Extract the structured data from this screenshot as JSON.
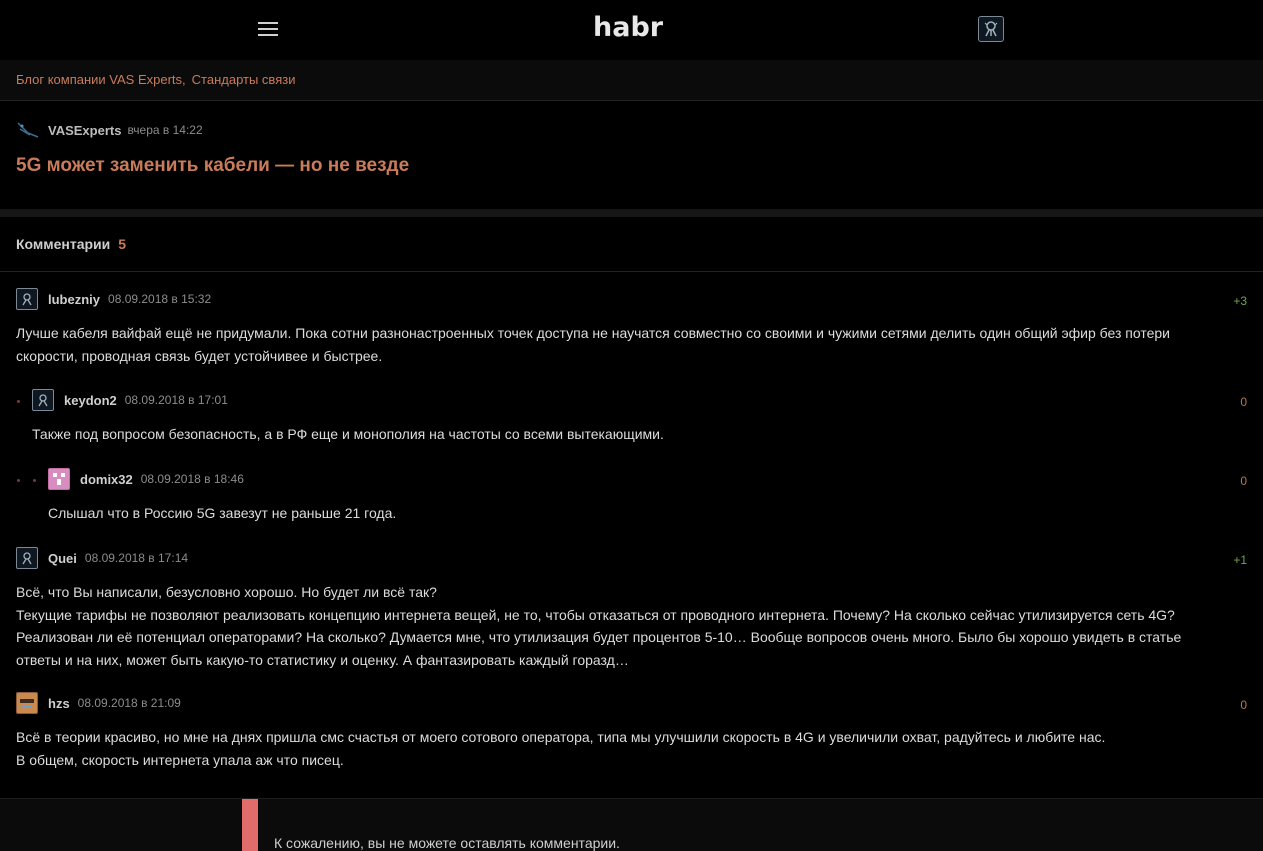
{
  "header": {
    "logo": "habr",
    "menu_icon": "hamburger-icon",
    "user_icon": "user-avatar-icon"
  },
  "hubs": [
    "Блог компании VAS Experts",
    "Стандарты связи"
  ],
  "post": {
    "author": "VASExperts",
    "time": "вчера в 14:22",
    "title": "5G может заменить кабели — но не везде"
  },
  "comments_header": {
    "label": "Комментарии",
    "count": "5"
  },
  "comments": [
    {
      "user": "lubezniy",
      "time": "08.09.2018 в 15:32",
      "score": "+3",
      "lines": [
        "Лучше кабеля вайфай ещё не придумали. Пока сотни разнонастроенных точек доступа не научатся совместно со своими и чужими сетями делить один общий эфир без потери",
        "скорости, проводная связь будет устойчивее и быстрее."
      ]
    },
    {
      "user": "keydon2",
      "time": "08.09.2018 в 17:01",
      "score": "0",
      "lines": [
        "Также под вопросом безопасность, а в РФ еще и монополия на частоты со всеми вытекающими."
      ]
    },
    {
      "user": "domix32",
      "time": "08.09.2018 в 18:46",
      "score": "0",
      "lines": [
        "Слышал что в Россию 5G завезут не раньше 21 года."
      ]
    },
    {
      "user": "Quei",
      "time": "08.09.2018 в 17:14",
      "score": "+1",
      "lines": [
        "Всё, что Вы написали, безусловно хорошо. Но будет ли всё так?",
        "Текущие тарифы не позволяют реализовать концепцию интернета вещей, не то, чтобы отказаться от проводного интернета. Почему? На сколько сейчас утилизируется сеть 4G?",
        "Реализован ли её потенциал операторами? На сколько? Думается мне, что утилизация будет процентов 5-10… Вообще вопросов очень много. Было бы хорошо увидеть в статье",
        "ответы и на них, может быть какую-то статистику и оценку. А фантазировать каждый горазд…"
      ]
    },
    {
      "user": "hzs",
      "time": "08.09.2018 в 21:09",
      "score": "0",
      "lines": [
        "Всё в теории красиво, но мне на днях пришла смс счастья от моего сотового оператора, типа мы улучшили скорость в 4G и увеличили охват, радуйтесь и любите нас.",
        "В общем, скорость интернета упала аж что писец."
      ]
    }
  ],
  "footer": {
    "notice": "К сожалению, вы не можете оставлять комментарии."
  },
  "colors": {
    "accent": "#c97b5a",
    "positive": "#6ea74a",
    "notice_bar": "#e06c6c"
  }
}
